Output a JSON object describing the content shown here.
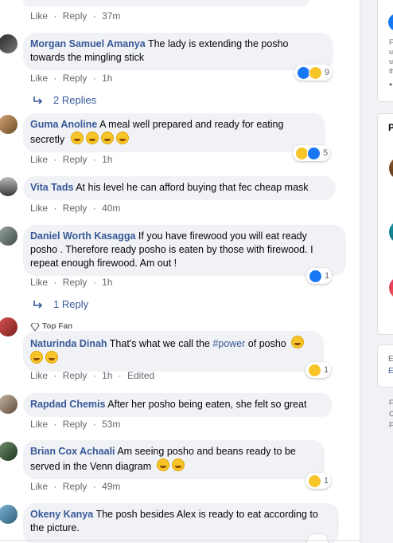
{
  "actions": {
    "like": "Like",
    "reply": "Reply",
    "dot": "·",
    "edited": "Edited"
  },
  "top_comment": {
    "time": "37m"
  },
  "comments": [
    {
      "name": "Morgan Samuel Amanya",
      "text": "The lady is extending the posho towards the mingling stick",
      "time": "1h",
      "reaction_count": "9",
      "replies": "2 Replies"
    },
    {
      "name": "Guma Anoline",
      "text": "A meal well prepared and ready for eating secretly",
      "time": "1h",
      "reaction_count": "5"
    },
    {
      "name": "Vita Tads",
      "text": "At his level he can afford buying that fec cheap mask",
      "time": "40m"
    },
    {
      "name": "Daniel Worth Kasagga",
      "text": "If you have firewood you will eat ready posho . Therefore ready posho is eaten by those with firewood. I repeat enough firewood. Am out !",
      "time": "1h",
      "reaction_count": "1",
      "replies": "1 Reply"
    },
    {
      "badge": "Top Fan",
      "name": "Naturinda Dinah",
      "text_before": "That's what we call the ",
      "hashtag": "#power",
      "text_after": " of posho",
      "time": "1h",
      "reaction_count": "1"
    },
    {
      "name": "Rapdad Chemis",
      "text": "After her posho being eaten, she felt so great",
      "time": "53m"
    },
    {
      "name": "Brian Cox Achaali",
      "text": "Am seeing posho and beans ready to be served in the Venn diagram",
      "time": "49m",
      "reaction_count": "1"
    },
    {
      "name": "Okeny Kanya",
      "text": "The posh besides Alex is ready to eat according to the picture."
    }
  ],
  "rail": {
    "card1_letter": "F",
    "card1_lines": [
      "F",
      "u",
      "u",
      "th"
    ],
    "card2_title": "P",
    "card3_lines": [
      "E",
      "E"
    ],
    "card4_lines": [
      "F",
      "C",
      "F"
    ]
  },
  "colors": {
    "link": "#385898",
    "bubble": "#f0f2f5",
    "meta": "#65676b",
    "like_blue": "#1877f2",
    "haha_yellow": "#f7c52a"
  }
}
